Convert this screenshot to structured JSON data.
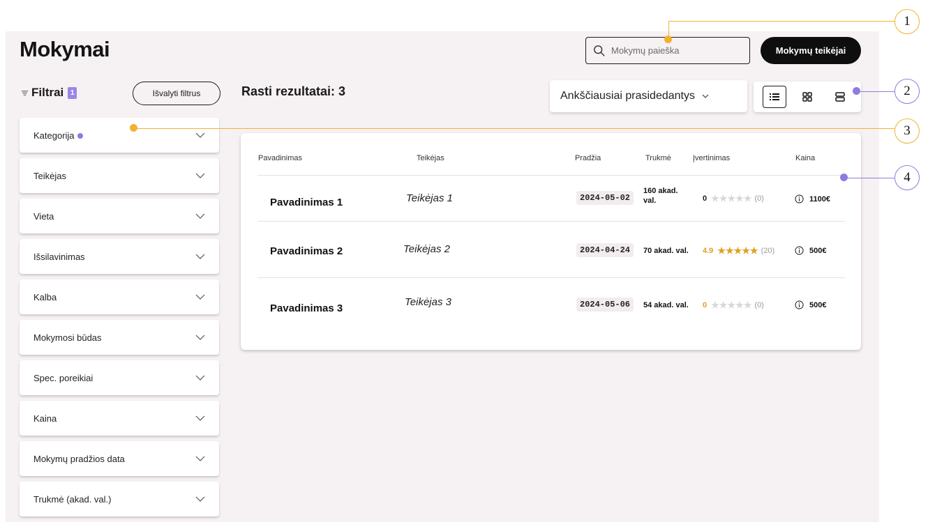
{
  "page": {
    "title": "Mokymai"
  },
  "search": {
    "placeholder": "Mokymų paieška"
  },
  "header": {
    "providers_label": "Mokymų teikėjai"
  },
  "filters": {
    "title": "Filtrai",
    "active_count": "1",
    "clear_label": "Išvalyti filtrus",
    "items": [
      {
        "label": "Kategorija"
      },
      {
        "label": "Teikėjas"
      },
      {
        "label": "Vieta"
      },
      {
        "label": "Išsilavinimas"
      },
      {
        "label": "Kalba"
      },
      {
        "label": "Mokymosi būdas"
      },
      {
        "label": "Spec. poreikiai"
      },
      {
        "label": "Kaina"
      },
      {
        "label": "Mokymų pradžios data"
      },
      {
        "label": "Trukmė (akad. val.)"
      }
    ]
  },
  "results": {
    "label": "Rasti rezultatai: 3"
  },
  "sort": {
    "selected": "Ankščiausiai prasidedantys"
  },
  "table": {
    "headers": {
      "name": "Pavadinimas",
      "provider": "Teikėjas",
      "start": "Pradžia",
      "duration": "Trukmė",
      "rating": "Įvertinimas",
      "price": "Kaina"
    },
    "rows": [
      {
        "name": "Pavadinimas 1",
        "provider": "Teikėjas 1",
        "start": "2024-05-02",
        "duration": "160 akad. val.",
        "rating": "0",
        "stars_filled": 0,
        "reviews": "(0)",
        "price": "1100€"
      },
      {
        "name": "Pavadinimas 2",
        "provider": "Teikėjas 2",
        "start": "2024-04-24",
        "duration": "70 akad. val.",
        "rating": "4.9",
        "stars_filled": 5,
        "reviews": "(20)",
        "price": "500€"
      },
      {
        "name": "Pavadinimas 3",
        "provider": "Teikėjas 3",
        "start": "2024-05-06",
        "duration": "54 akad. val.",
        "rating": "0",
        "stars_filled": 0,
        "reviews": "(0)",
        "price": "500€"
      }
    ]
  },
  "annotations": [
    "1",
    "2",
    "3",
    "4"
  ],
  "colors": {
    "accent_purple": "#8f7be0",
    "accent_yellow": "#f2b230",
    "page_bg": "#f6f1f2",
    "dark": "#0e0e0e",
    "rating_orange": "#e0a020",
    "star_empty": "#d8d8d8"
  }
}
